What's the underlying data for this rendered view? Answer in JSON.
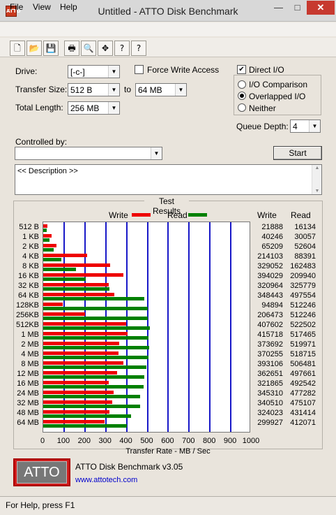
{
  "window": {
    "title": "Untitled - ATTO Disk Benchmark",
    "app_icon": "ATTO",
    "minimize": "—",
    "maximize": "□",
    "close": "✕"
  },
  "menu": [
    "File",
    "View",
    "Help"
  ],
  "toolbar": {
    "icons": [
      "new-icon",
      "open-icon",
      "save-icon",
      "print-icon",
      "print-preview-icon",
      "move-icon",
      "help-icon",
      "context-help-icon"
    ],
    "glyphs": [
      "🗋",
      "📂",
      "💾",
      "🖶",
      "🔍",
      "✥",
      "?",
      "?"
    ]
  },
  "form": {
    "drive_label": "Drive:",
    "drive_value": "[-c-]",
    "transfer_size_label": "Transfer Size:",
    "transfer_from": "512 B",
    "transfer_to_label": "to",
    "transfer_to": "64 MB",
    "total_length_label": "Total Length:",
    "total_length": "256 MB",
    "force_write_label": "Force Write Access",
    "force_write_checked": false,
    "direct_io_label": "Direct I/O",
    "direct_io_checked": true,
    "radio_io_comparison": "I/O Comparison",
    "radio_overlapped": "Overlapped I/O",
    "radio_neither": "Neither",
    "selected_radio": "Overlapped I/O",
    "queue_depth_label": "Queue Depth:",
    "queue_depth": "4",
    "controlled_by_label": "Controlled by:",
    "controlled_by_value": "",
    "start_button": "Start",
    "description": "<< Description >>"
  },
  "results": {
    "group_title": "Test Results",
    "legend_write": "Write",
    "legend_read": "Read",
    "col_write": "Write",
    "col_read": "Read",
    "xlabel": "Transfer Rate - MB / Sec",
    "colors": {
      "write": "#ee0000",
      "read": "#008000"
    }
  },
  "chart_data": {
    "type": "bar",
    "orientation": "horizontal",
    "title": "Test Results",
    "xlabel": "Transfer Rate - MB / Sec",
    "xlim": [
      0,
      1000
    ],
    "xticks": [
      0,
      100,
      200,
      300,
      400,
      500,
      600,
      700,
      800,
      900,
      1000
    ],
    "grid": true,
    "legend": "top",
    "categories": [
      "512 B",
      "1 KB",
      "2 KB",
      "4 KB",
      "8 KB",
      "16 KB",
      "32 KB",
      "64 KB",
      "128KB",
      "256KB",
      "512KB",
      "1 MB",
      "2 MB",
      "4 MB",
      "8 MB",
      "12 MB",
      "16 MB",
      "24 MB",
      "32 MB",
      "48 MB",
      "64 MB"
    ],
    "series": [
      {
        "name": "Write",
        "values": [
          21888,
          40246,
          65209,
          214103,
          329052,
          394029,
          320964,
          348443,
          94894,
          206473,
          407602,
          415718,
          373692,
          370255,
          393106,
          362651,
          321865,
          345310,
          340510,
          324023,
          299927
        ]
      },
      {
        "name": "Read",
        "values": [
          16134,
          30057,
          52604,
          88391,
          162483,
          209940,
          325779,
          497554,
          512246,
          512246,
          522502,
          517465,
          519971,
          518715,
          506481,
          497661,
          492542,
          477282,
          475107,
          431414,
          412071
        ]
      }
    ],
    "value_units": "KB/s"
  },
  "footer": {
    "logo": "ATTO",
    "product": "ATTO Disk Benchmark v3.05",
    "url": "www.attotech.com"
  },
  "status": "For Help, press F1"
}
